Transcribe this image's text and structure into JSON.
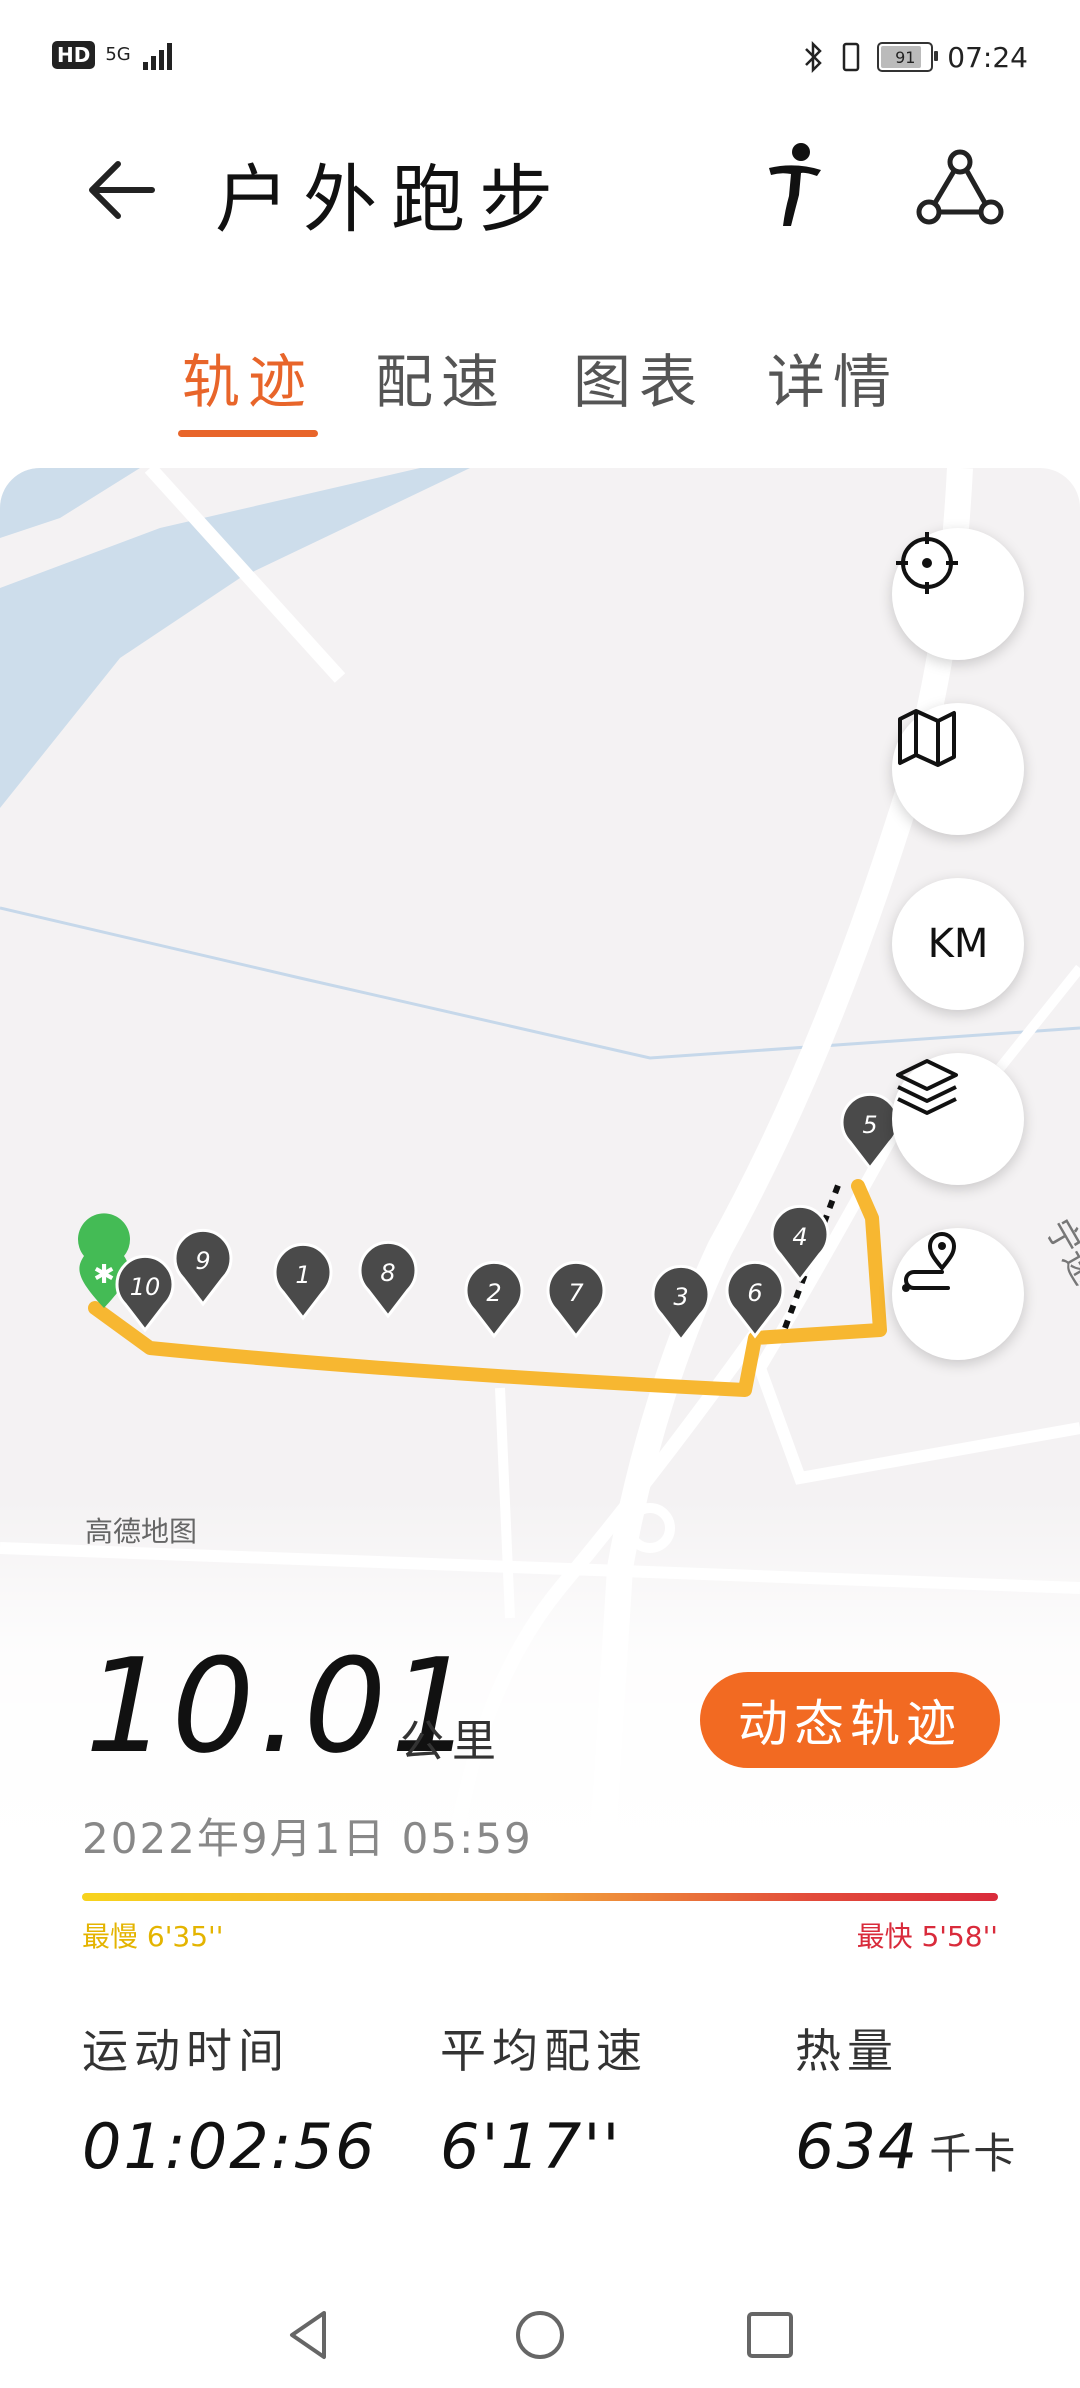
{
  "status_bar": {
    "hd": "HD",
    "network": "5G",
    "battery": "91",
    "battery_level": 0.91,
    "time": "07:24"
  },
  "header": {
    "title": "户外跑步",
    "icons": [
      "back-arrow-icon",
      "runner-icon",
      "route-share-icon"
    ]
  },
  "tabs": [
    {
      "label": "轨迹",
      "active": true
    },
    {
      "label": "配速",
      "active": false
    },
    {
      "label": "图表",
      "active": false
    },
    {
      "label": "详情",
      "active": false
    }
  ],
  "map": {
    "provider": "高德地图",
    "controls": [
      "locate-icon",
      "map-icon",
      "KM",
      "layers-icon",
      "route-pin-icon"
    ],
    "km_label": "KM",
    "road_label": "宁速",
    "km_markers": [
      "1",
      "2",
      "3",
      "4",
      "5",
      "6",
      "7",
      "8",
      "9",
      "10"
    ]
  },
  "summary": {
    "distance": "10.01",
    "distance_unit": "公里",
    "dynamic_track_button": "动态轨迹",
    "datetime": "2022年9月1日  05:59",
    "slowest": "最慢 6'35''",
    "fastest": "最快 5'58''"
  },
  "stats": [
    {
      "label": "运动时间",
      "value": "01:02:56",
      "unit": ""
    },
    {
      "label": "平均配速",
      "value": "6'17''",
      "unit": ""
    },
    {
      "label": "热量",
      "value": "634",
      "unit": "千卡"
    }
  ],
  "colors": {
    "accent": "#e8652a",
    "button": "#f26a22",
    "track": "#f7b731"
  }
}
